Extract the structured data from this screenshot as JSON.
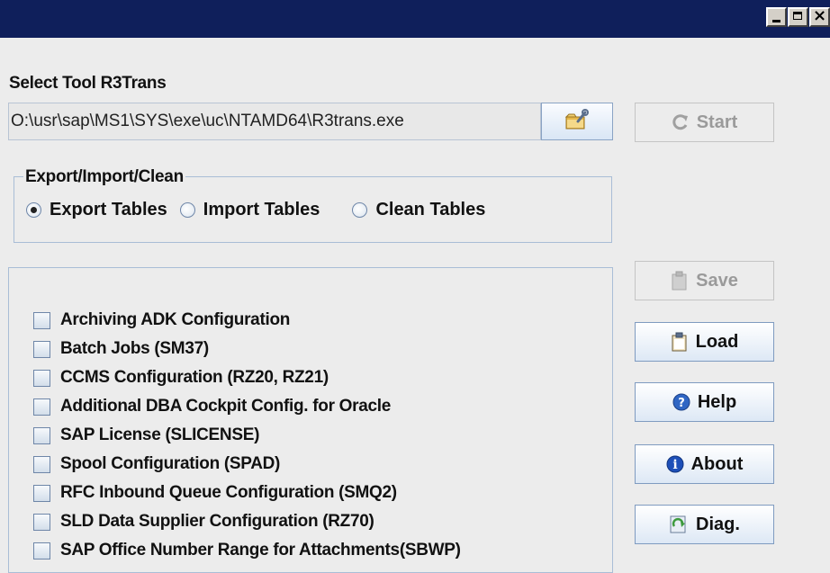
{
  "window": {
    "title": "",
    "controls": [
      "minimize-icon",
      "maximize-icon",
      "close-icon"
    ]
  },
  "tool": {
    "label": "Select Tool R3Trans",
    "path": "O:\\usr\\sap\\MS1\\SYS\\exe\\uc\\NTAMD64\\R3trans.exe",
    "browse_icon": "folder-wrench-icon"
  },
  "buttons": {
    "start": "Start",
    "save": "Save",
    "load": "Load",
    "help": "Help",
    "about": "About",
    "diag": "Diag."
  },
  "mode": {
    "group_title": "Export/Import/Clean",
    "options": [
      "Export Tables",
      "Import Tables",
      "Clean Tables"
    ],
    "selected": "Export Tables"
  },
  "tables": {
    "items": [
      "Archiving ADK Configuration",
      "Batch Jobs (SM37)",
      "CCMS Configuration (RZ20, RZ21)",
      "Additional DBA Cockpit Config. for Oracle",
      "SAP License (SLICENSE)",
      "Spool Configuration (SPAD)",
      "RFC Inbound Queue Configuration (SMQ2)",
      "SLD Data Supplier Configuration (RZ70)",
      "SAP Office Number Range for Attachments(SBWP)"
    ]
  },
  "colors": {
    "titlebar": "#0f1f5b",
    "background": "#ececec",
    "button_border": "#7f9bc0",
    "disabled_text": "#9a9a9a"
  }
}
